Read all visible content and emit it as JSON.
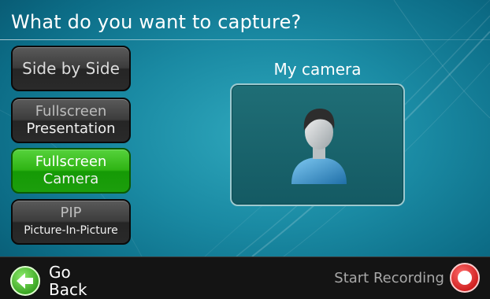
{
  "header": {
    "title": "What do you want to capture?"
  },
  "modes": [
    {
      "line1": "Side by Side",
      "line2": "",
      "active": false
    },
    {
      "line1": "Fullscreen",
      "line2": "Presentation",
      "active": false
    },
    {
      "line1": "Fullscreen",
      "line2": "Camera",
      "active": true
    },
    {
      "line1": "PIP",
      "line2": "Picture-In-Picture",
      "active": false
    }
  ],
  "preview": {
    "label": "My camera",
    "icon": "person-silhouette-icon"
  },
  "footer": {
    "back_label": "Go Back",
    "back_icon": "left-arrow-icon",
    "record_label": "Start Recording",
    "record_icon": "record-icon"
  },
  "colors": {
    "accent_active": "#2fb414",
    "background": "#1a8aa3",
    "record": "#e8282a"
  }
}
